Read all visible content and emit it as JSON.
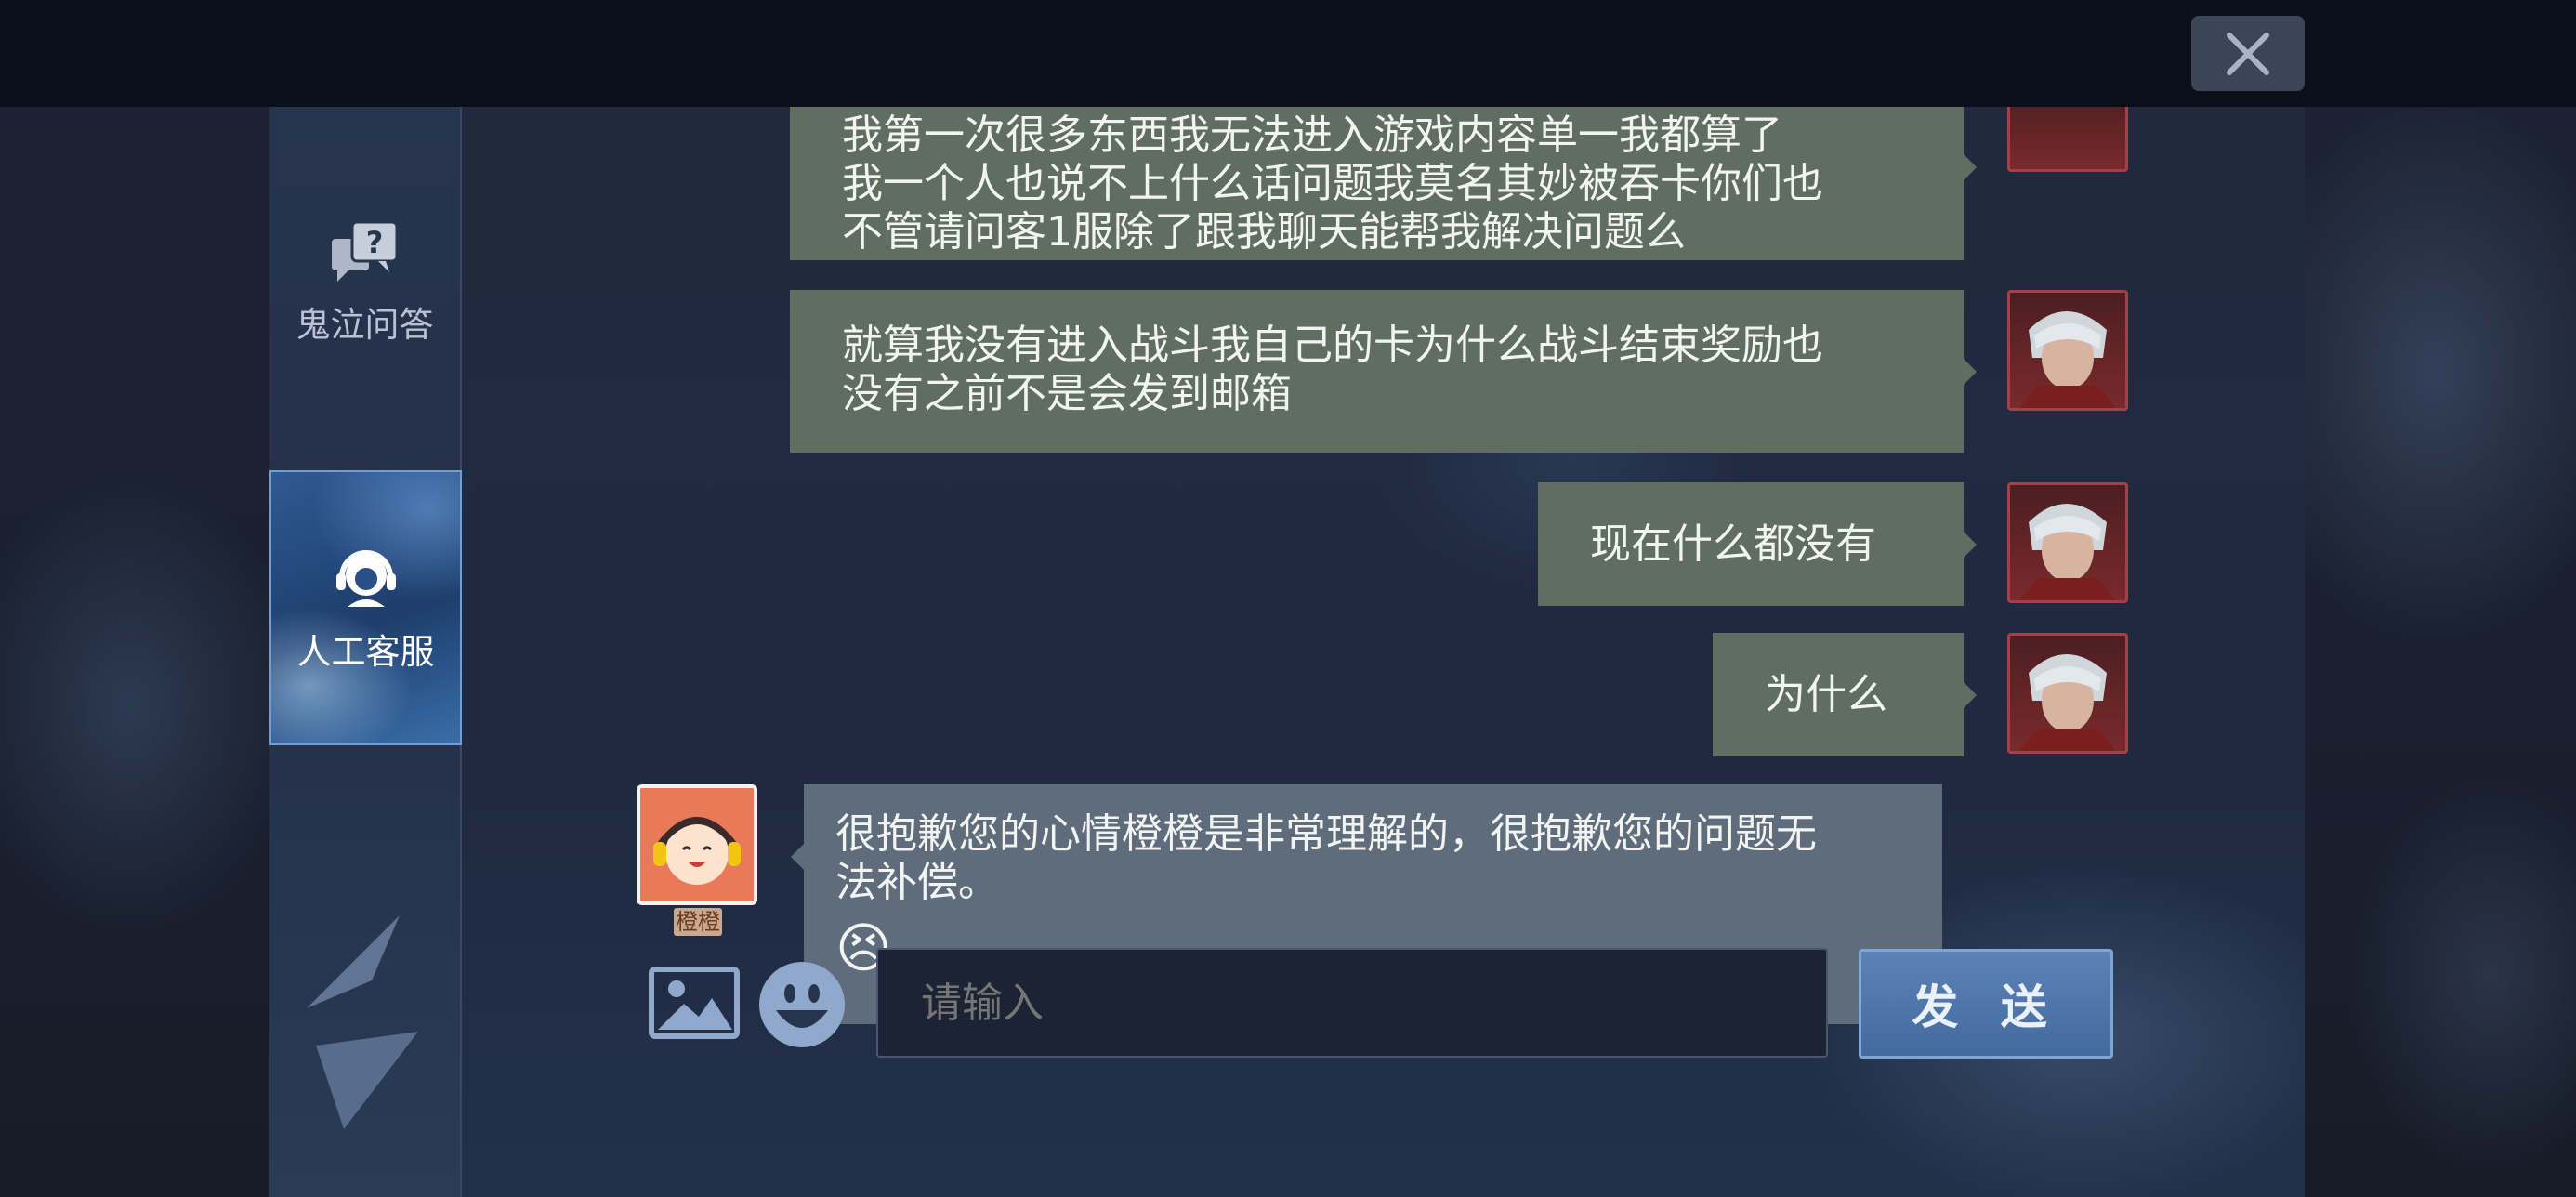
{
  "sidebar": {
    "items": [
      {
        "label": "鬼泣问答",
        "icon": "question-bubbles-icon"
      },
      {
        "label": "人工客服",
        "icon": "headset-agent-icon"
      }
    ]
  },
  "messages": [
    {
      "sender": "user",
      "text": "我第一次很多东西我无法进入游戏内容单一我都算了\n我一个人也说不上什么话问题我莫名其妙被吞卡你们也\n不管请问客1服除了跟我聊天能帮我解决问题么"
    },
    {
      "sender": "user",
      "text": "就算我没有进入战斗我自己的卡为什么战斗结束奖励也\n没有之前不是会发到邮箱"
    },
    {
      "sender": "user",
      "text": "现在什么都没有"
    },
    {
      "sender": "user",
      "text": "为什么"
    },
    {
      "sender": "agent",
      "name": "橙橙",
      "text": "很抱歉您的心情橙橙是非常理解的，很抱歉您的问题无\n法补偿。",
      "emoji": "😣"
    }
  ],
  "input": {
    "placeholder": "请输入",
    "value": ""
  },
  "buttons": {
    "send": "发 送"
  },
  "icons": {
    "close": "close-icon",
    "image": "image-icon",
    "emoji": "emoji-icon"
  }
}
